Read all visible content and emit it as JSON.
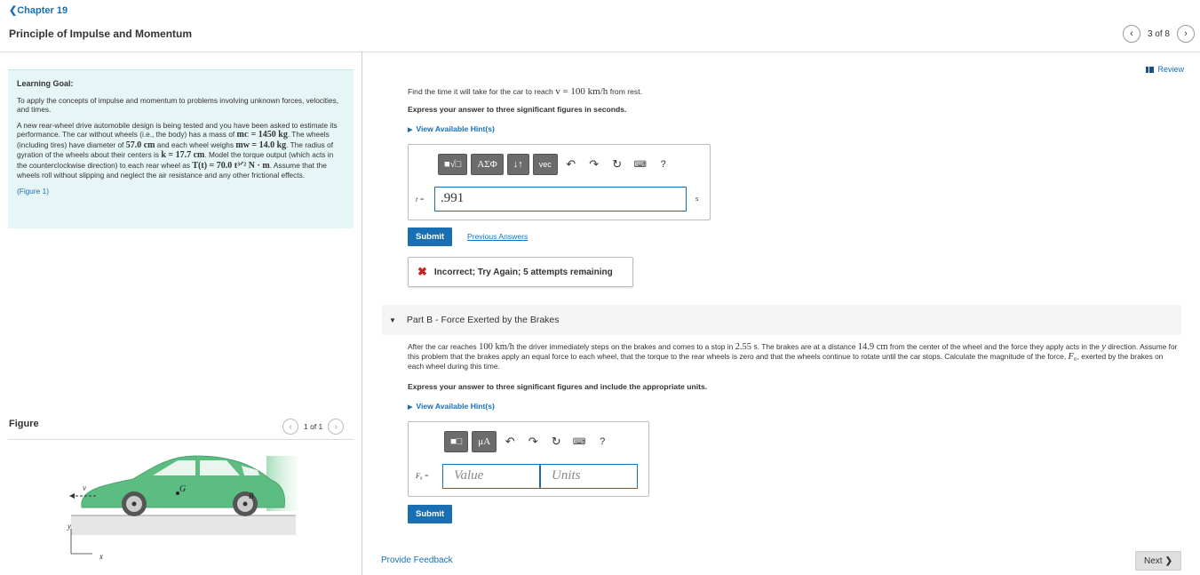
{
  "header": {
    "back_link": "Chapter 19",
    "title": "Principle of Impulse and Momentum",
    "pager_text": "3 of 8"
  },
  "learning_goal": {
    "title": "Learning Goal:",
    "goal": "To apply the concepts of impulse and momentum to problems involving unknown forces, velocities, and times.",
    "p1": "A new rear-wheel drive automobile design is being tested and you have been asked to estimate its performance. The car without wheels (i.e., the body) has a mass of",
    "mc": "mᴄ = 1450 kg",
    "p2": ". The wheels (including tires) have diameter of",
    "diameter": "57.0 cm",
    "p3": "and each wheel weighs",
    "mw": "mᴡ = 14.0 kg",
    "p4": ". The radius of gyration of the wheels about their centers is",
    "k": "k = 17.7 cm",
    "p5": ". Model the torque output (which acts in the counterclockwise direction) to each rear wheel as",
    "torque": "T(t) = 70.0 t³ᐟ² N · m",
    "p6": ". Assume that the wheels roll without slipping and neglect the air resistance and any other frictional effects.",
    "figure_link": "(Figure 1)"
  },
  "figure": {
    "label": "Figure",
    "pager_text": "1 of 1",
    "labels": {
      "v": "v",
      "g": "G",
      "b": "B",
      "y": "y",
      "x": "x"
    }
  },
  "review_label": "Review",
  "part_a": {
    "q_pre": "Find the time it will take for the car to reach",
    "q_math": "v = 100 km/h",
    "q_post": "from rest.",
    "instruction": "Express your answer to three significant figures in seconds.",
    "hint": "View Available Hint(s)",
    "toolbar": {
      "templates": "■√□",
      "greek": "ΑΣΦ",
      "arrows": "↓↑",
      "vec": "vec",
      "help": "?"
    },
    "var_label": "t =",
    "value": ".991",
    "unit": "s",
    "submit": "Submit",
    "previous_answers": "Previous Answers",
    "feedback": "Incorrect; Try Again; 5 attempts remaining"
  },
  "part_b": {
    "heading_bold": "Part B",
    "heading_rest": " - Force Exerted by the Brakes",
    "s1": "After the car reaches",
    "speed": "100 km/h",
    "s2": "the driver immediately steps on the brakes and comes to a stop in",
    "time": "2.55 s",
    "s3": ". The brakes are at a distance",
    "dist": "14.9 cm",
    "s4": "from the center of the wheel and the force they apply acts in the",
    "ydir": "y",
    "s5": "direction. Assume for this problem that the brakes apply an equal force to each wheel, that the torque to the rear wheels is zero and that the wheels continue to rotate until the car stops. Calculate the magnitude of the force,",
    "fb": "F₆",
    "s6": ", exerted by the brakes on each wheel during this time.",
    "instruction": "Express your answer to three significant figures and include the appropriate units.",
    "hint": "View Available Hint(s)",
    "toolbar": {
      "templates": "■□",
      "mu": "μA",
      "help": "?"
    },
    "var_label": "F₆ =",
    "value_placeholder": "Value",
    "units_placeholder": "Units",
    "submit": "Submit"
  },
  "footer": {
    "provide_feedback": "Provide Feedback",
    "next": "Next"
  }
}
